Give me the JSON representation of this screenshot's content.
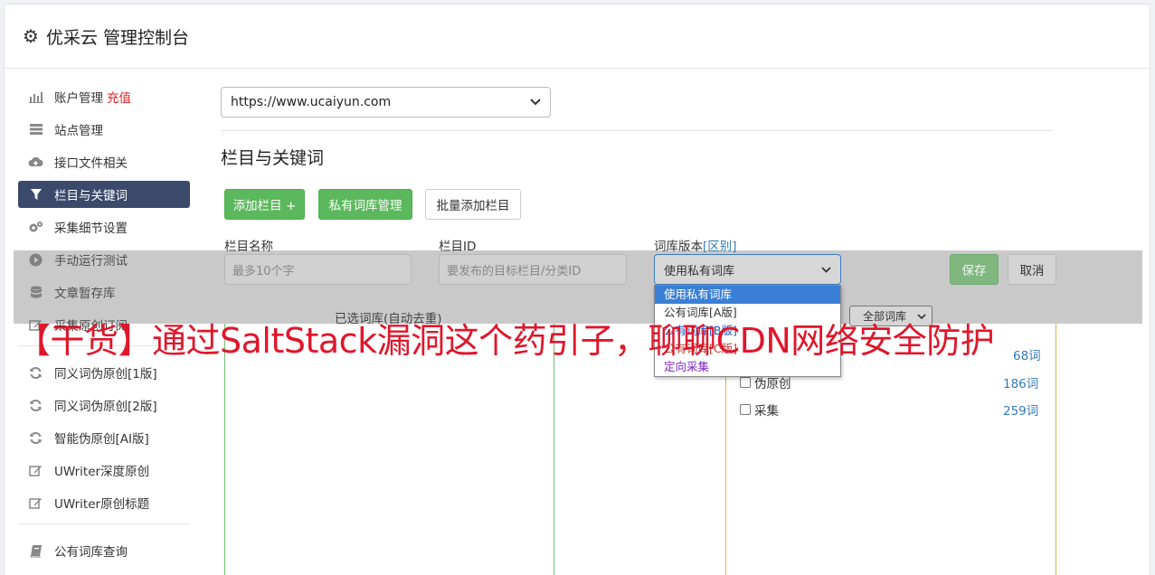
{
  "header": {
    "title": "优采云 管理控制台",
    "icon": "gear-icon"
  },
  "sidebar": {
    "items": [
      {
        "label": "账户管理",
        "extra": "充值",
        "icon": "bar-chart-icon"
      },
      {
        "label": "站点管理",
        "icon": "server-icon"
      },
      {
        "label": "接口文件相关",
        "icon": "cloud-upload-icon"
      },
      {
        "label": "栏目与关键词",
        "icon": "filter-icon",
        "active": true
      },
      {
        "label": "采集细节设置",
        "icon": "cogs-icon"
      },
      {
        "label": "手动运行测试",
        "icon": "play-circle-icon"
      },
      {
        "label": "文章暂存库",
        "icon": "database-icon"
      },
      {
        "label": "采集原创订阅",
        "icon": "edit-icon"
      },
      {
        "label": "同义词伪原创[1版]",
        "icon": "refresh-icon"
      },
      {
        "label": "同义词伪原创[2版]",
        "icon": "refresh-icon"
      },
      {
        "label": "智能伪原创[AI版]",
        "icon": "refresh-icon"
      },
      {
        "label": "UWriter深度原创",
        "icon": "edit-icon"
      },
      {
        "label": "UWriter原创标题",
        "icon": "edit-icon"
      },
      {
        "label": "公有词库查询",
        "icon": "book-icon"
      }
    ]
  },
  "main": {
    "site_select_value": "https://www.ucaiyun.com",
    "section_title": "栏目与关键词",
    "buttons": {
      "add_column": "添加栏目 +",
      "private_lib": "私有词库管理",
      "batch_add": "批量添加栏目"
    },
    "form": {
      "col_name_label": "栏目名称",
      "col_id_label": "栏目ID",
      "lib_version_label": "词库版本",
      "lib_version_link": "[区别]",
      "col_name_placeholder": "最多10个字",
      "col_id_placeholder": "要发布的目标栏目/分类ID",
      "lib_version_value": "使用私有词库",
      "save": "保存",
      "cancel": "取消"
    },
    "dropdown_options": [
      {
        "label": "使用私有词库",
        "color": "#ffffff"
      },
      {
        "label": "公有词库[A版]",
        "color": "#333333"
      },
      {
        "label": "公有词库[B版]",
        "color": "#1a56c8"
      },
      {
        "label": "公有词库[C版]",
        "color": "#c0392b"
      },
      {
        "label": "定向采集",
        "color": "#7b1fc4"
      }
    ],
    "selected_lib_label": "已选词库(自动去重)",
    "all_lib_filter": "全部词库",
    "libraries": [
      {
        "name": "伪原创",
        "count": "186词"
      },
      {
        "name": "采集",
        "count": "259词"
      }
    ],
    "partial_count": "68词"
  },
  "banner_text": "【干货】通过SaltStack漏洞这个药引子，聊聊CDN网络安全防护"
}
